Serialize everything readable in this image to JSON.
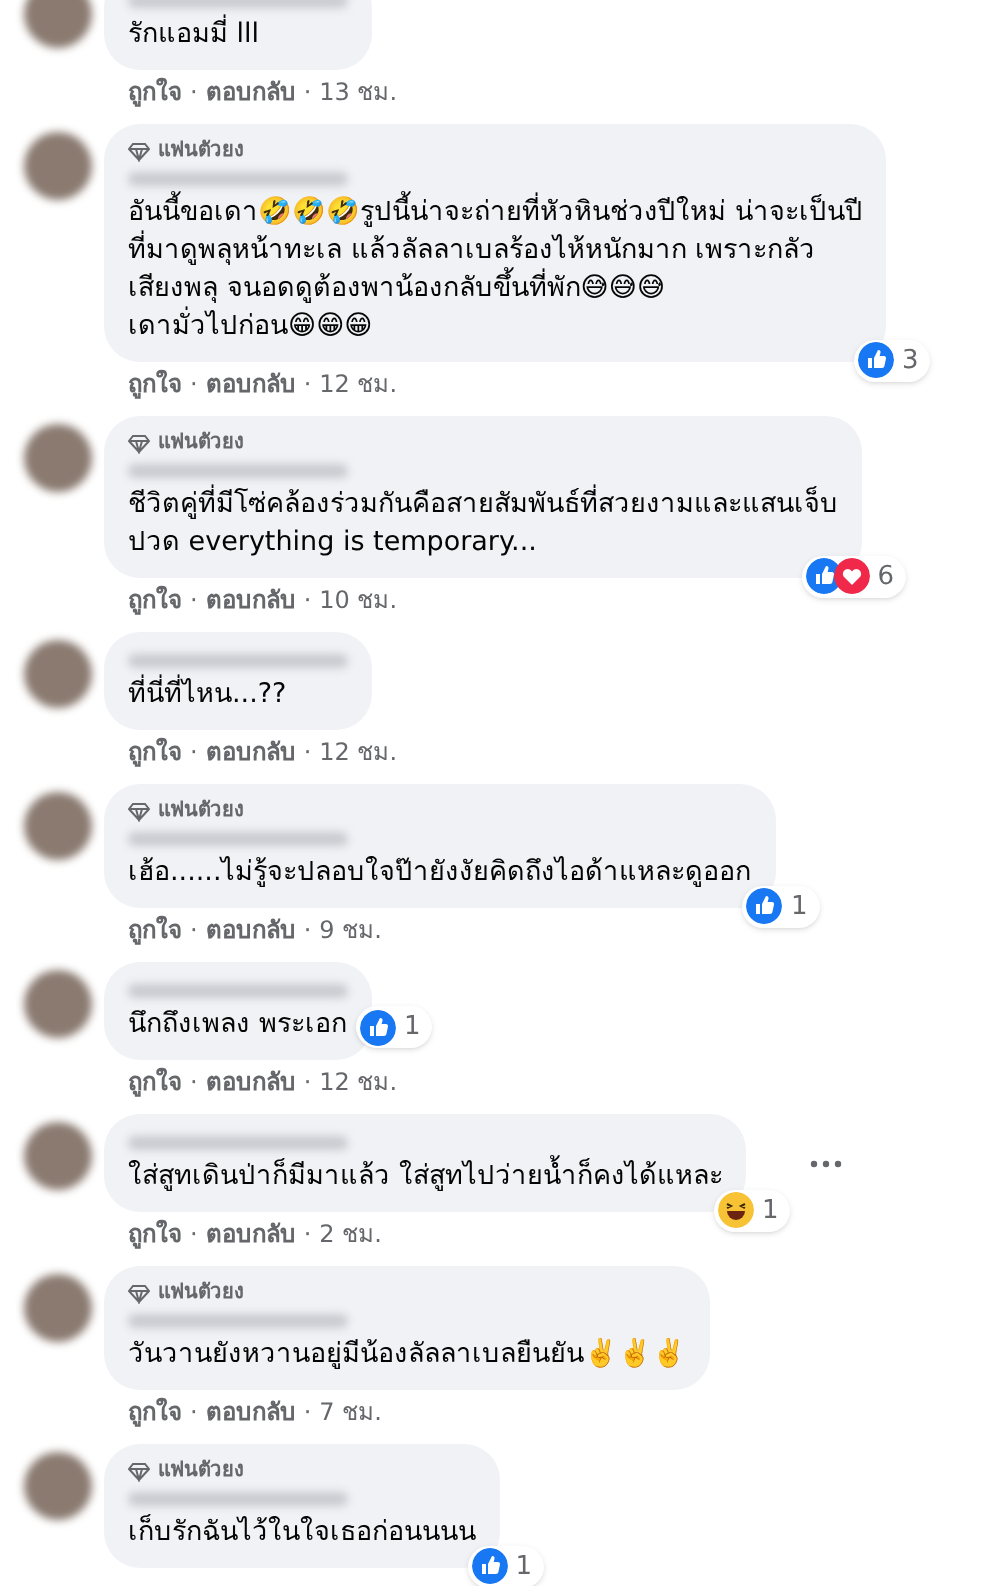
{
  "comments": [
    {
      "cut_top": true,
      "lines": [
        "รักแอมมี่ lll"
      ],
      "meta": [
        {
          "kind": "link",
          "text": "ถูกใจ"
        },
        {
          "kind": "dot",
          "text": "·"
        },
        {
          "kind": "link",
          "text": "ตอบกลับ"
        },
        {
          "kind": "dot",
          "text": "·"
        },
        {
          "kind": "time",
          "text": "13 ชม."
        }
      ]
    },
    {
      "fan_badge": "แฟนตัวยง",
      "lines": [
        "อันนี้ขอเดา🤣🤣🤣รูปนี้น่าจะถ่ายที่หัวหินช่วงปีใหม่ น่าจะเป็นปี",
        "ที่มาดูพลุหน้าทะเล แล้วลัลลาเบลร้องไห้หนักมาก เพราะกลัว",
        "เสียงพลุ จนอดดูต้องพาน้องกลับขึ้นที่พัก😅😅😅",
        "เดามั่วไปก่อน😁😁😁"
      ],
      "meta": [
        {
          "kind": "link",
          "text": "ถูกใจ"
        },
        {
          "kind": "dot",
          "text": "·"
        },
        {
          "kind": "link",
          "text": "ตอบกลับ"
        },
        {
          "kind": "dot",
          "text": "·"
        },
        {
          "kind": "time",
          "text": "12 ชม."
        }
      ],
      "reactions": {
        "kind": "corner",
        "icons": [
          {
            "kind": "like"
          }
        ],
        "count": "3"
      }
    },
    {
      "fan_badge": "แฟนตัวยง",
      "lines": [
        "ชีวิตคู่ที่มีโซ่คล้องร่วมกันคือสายสัมพันธ์ที่สวยงามและแสนเจ็บ",
        "ปวด everything is temporary..."
      ],
      "meta": [
        {
          "kind": "link",
          "text": "ถูกใจ"
        },
        {
          "kind": "dot",
          "text": "·"
        },
        {
          "kind": "link",
          "text": "ตอบกลับ"
        },
        {
          "kind": "dot",
          "text": "·"
        },
        {
          "kind": "time",
          "text": "10 ชม."
        }
      ],
      "reactions": {
        "kind": "corner",
        "icons": [
          {
            "kind": "like"
          },
          {
            "kind": "love"
          }
        ],
        "count": "6"
      }
    },
    {
      "lines": [
        "ที่นี่ที่ไหน...??"
      ],
      "meta": [
        {
          "kind": "link",
          "text": "ถูกใจ"
        },
        {
          "kind": "dot",
          "text": "·"
        },
        {
          "kind": "link",
          "text": "ตอบกลับ"
        },
        {
          "kind": "dot",
          "text": "·"
        },
        {
          "kind": "time",
          "text": "12 ชม."
        }
      ]
    },
    {
      "fan_badge": "แฟนตัวยง",
      "lines": [
        "เฮ้อ......ไม่รู้จะปลอบใจป๊ายังงัยคิดถึงไอด้าแหละดูออก"
      ],
      "meta": [
        {
          "kind": "link",
          "text": "ถูกใจ"
        },
        {
          "kind": "dot",
          "text": "·"
        },
        {
          "kind": "link",
          "text": "ตอบกลับ"
        },
        {
          "kind": "dot",
          "text": "·"
        },
        {
          "kind": "time",
          "text": "9 ชม."
        }
      ],
      "reactions": {
        "kind": "corner",
        "icons": [
          {
            "kind": "like"
          }
        ],
        "count": "1"
      }
    },
    {
      "lines": [
        "นึกถึงเพลง พระเอก"
      ],
      "meta": [
        {
          "kind": "link",
          "text": "ถูกใจ"
        },
        {
          "kind": "dot",
          "text": "·"
        },
        {
          "kind": "link",
          "text": "ตอบกลับ"
        },
        {
          "kind": "dot",
          "text": "·"
        },
        {
          "kind": "time",
          "text": "12 ชม."
        }
      ],
      "reactions": {
        "kind": "inline",
        "icons": [
          {
            "kind": "like"
          }
        ],
        "count": "1"
      }
    },
    {
      "menu": true,
      "lines": [
        "ใส่สูทเดินป่าก็มีมาแล้ว ใส่สูทไปว่ายน้ำก็คงได้แหละ"
      ],
      "meta": [
        {
          "kind": "link",
          "text": "ถูกใจ"
        },
        {
          "kind": "dot",
          "text": "·"
        },
        {
          "kind": "link",
          "text": "ตอบกลับ"
        },
        {
          "kind": "dot",
          "text": "·"
        },
        {
          "kind": "time",
          "text": "2 ชม."
        }
      ],
      "reactions": {
        "kind": "corner",
        "icons": [
          {
            "kind": "haha"
          }
        ],
        "count": "1"
      }
    },
    {
      "fan_badge": "แฟนตัวยง",
      "lines": [
        "วันวานยังหวานอยู่มีน้องลัลลาเบลยืนยัน✌️✌️✌️"
      ],
      "meta": [
        {
          "kind": "link",
          "text": "ถูกใจ"
        },
        {
          "kind": "dot",
          "text": "·"
        },
        {
          "kind": "link",
          "text": "ตอบกลับ"
        },
        {
          "kind": "dot",
          "text": "·"
        },
        {
          "kind": "time",
          "text": "7 ชม."
        }
      ]
    },
    {
      "fan_badge": "แฟนตัวยง",
      "lines": [
        "เก็บรักฉันไว้ในใจเธอก่อนนนน"
      ],
      "reactions": {
        "kind": "corner",
        "icons": [
          {
            "kind": "like"
          }
        ],
        "count": "1"
      }
    }
  ]
}
